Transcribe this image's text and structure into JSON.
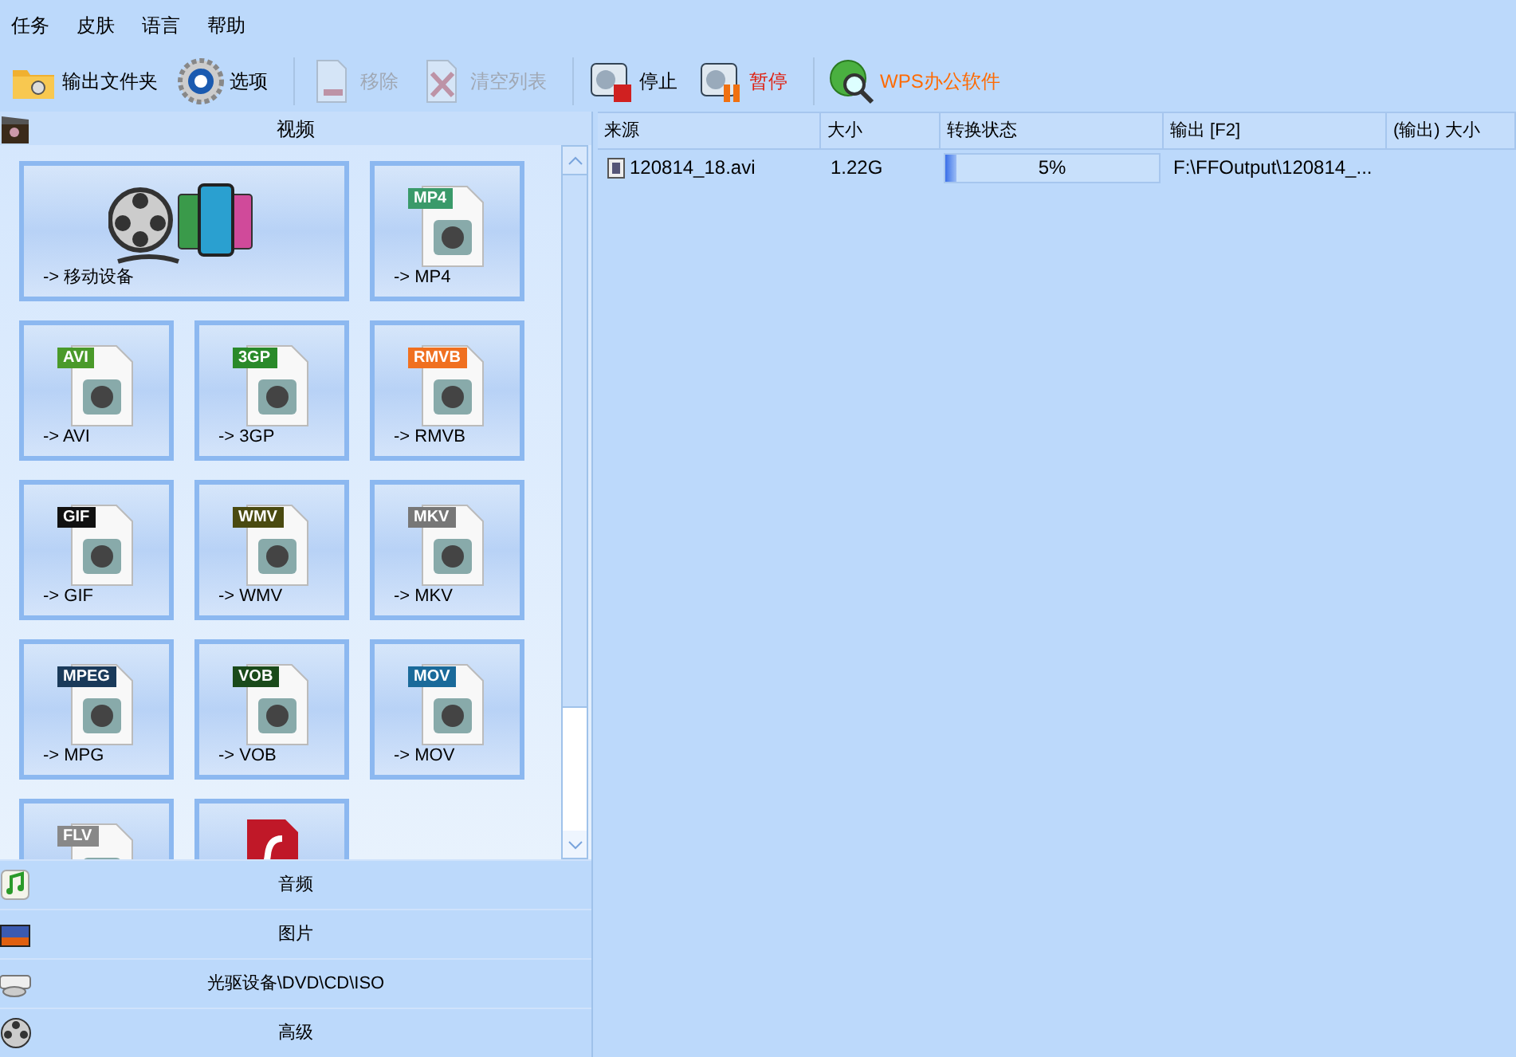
{
  "menu": [
    "任务",
    "皮肤",
    "语言",
    "帮助"
  ],
  "toolbar": [
    {
      "kind": "folder",
      "label": "输出文件夹",
      "disabled": false,
      "color": "#000000"
    },
    {
      "kind": "gear",
      "label": "选项",
      "disabled": false,
      "color": "#000000"
    },
    {
      "kind": "remove",
      "label": "移除",
      "disabled": true,
      "color": "#a0a8b4"
    },
    {
      "kind": "clear",
      "label": "清空列表",
      "disabled": true,
      "color": "#a0a8b4"
    },
    {
      "kind": "stop",
      "label": "停止",
      "disabled": false,
      "color": "#000000"
    },
    {
      "kind": "pause",
      "label": "暂停",
      "disabled": false,
      "color": "#e02010"
    },
    {
      "kind": "globe",
      "label": "WPS办公软件",
      "disabled": false,
      "color": "#ff6a00"
    }
  ],
  "sections": [
    {
      "kind": "video",
      "label": "视频",
      "tiles": [
        {
          "kind": "device",
          "label": "-> 移动设备"
        },
        {
          "kind": "file",
          "badge": "MP4",
          "color": "#3a9a6a",
          "label": "-> MP4"
        },
        {
          "kind": "file",
          "badge": "AVI",
          "color": "#4a9a2a",
          "label": "-> AVI"
        },
        {
          "kind": "file",
          "badge": "3GP",
          "color": "#2a8a2a",
          "label": "-> 3GP"
        },
        {
          "kind": "file",
          "badge": "RMVB",
          "color": "#f07020",
          "label": "-> RMVB"
        },
        {
          "kind": "file",
          "badge": "GIF",
          "color": "#111111",
          "label": "-> GIF"
        },
        {
          "kind": "file",
          "badge": "WMV",
          "color": "#4a4a10",
          "label": "-> WMV"
        },
        {
          "kind": "file",
          "badge": "MKV",
          "color": "#777777",
          "label": "-> MKV"
        },
        {
          "kind": "file",
          "badge": "MPEG",
          "color": "#1a3a5a",
          "label": "-> MPG"
        },
        {
          "kind": "file",
          "badge": "VOB",
          "color": "#1a4a1a",
          "label": "-> VOB"
        },
        {
          "kind": "file",
          "badge": "MOV",
          "color": "#1a6a9a",
          "label": "-> MOV"
        },
        {
          "kind": "file",
          "badge": "FLV",
          "color": "#888888"
        },
        {
          "kind": "flash"
        }
      ]
    },
    {
      "kind": "audio",
      "label": "音频"
    },
    {
      "kind": "image",
      "label": "图片"
    },
    {
      "kind": "disc",
      "label": "光驱设备\\DVD\\CD\\ISO"
    },
    {
      "kind": "advanced",
      "label": "高级"
    }
  ],
  "table": {
    "columns": [
      "来源",
      "大小",
      "转换状态",
      "输出 [F2]",
      "(输出) 大小"
    ],
    "rows": [
      {
        "source": "120814_18.avi",
        "size": "1.22G",
        "level": 0.05,
        "status": "5%",
        "output": "F:\\FFOutput\\120814_..."
      }
    ]
  }
}
